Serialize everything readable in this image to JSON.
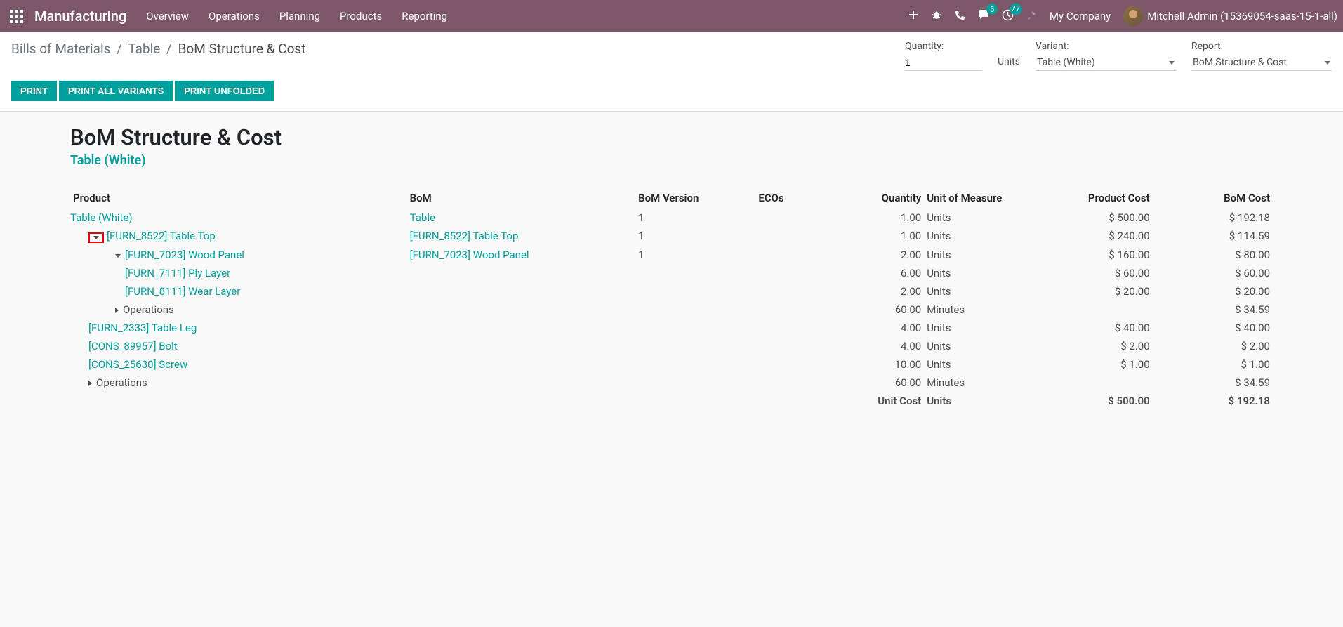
{
  "navbar": {
    "app_name": "Manufacturing",
    "menu": [
      "Overview",
      "Operations",
      "Planning",
      "Products",
      "Reporting"
    ],
    "messages_badge": "5",
    "activities_badge": "27",
    "company": "My Company",
    "user": "Mitchell Admin (15369054-saas-15-1-all)"
  },
  "breadcrumb": {
    "a": "Bills of Materials",
    "b": "Table",
    "current": "BoM Structure & Cost"
  },
  "fields": {
    "quantity_label": "Quantity:",
    "quantity_value": "1",
    "quantity_unit": "Units",
    "variant_label": "Variant:",
    "variant_value": "Table (White)",
    "report_label": "Report:",
    "report_value": "BoM Structure & Cost"
  },
  "buttons": {
    "print": "Print",
    "print_all": "Print All Variants",
    "print_unfolded": "Print Unfolded"
  },
  "report": {
    "title": "BoM Structure & Cost",
    "subtitle": "Table (White)"
  },
  "headers": {
    "product": "Product",
    "bom": "BoM",
    "version": "BoM Version",
    "ecos": "ECOs",
    "quantity": "Quantity",
    "uom": "Unit of Measure",
    "pcost": "Product Cost",
    "bcost": "BoM Cost"
  },
  "rows": [
    {
      "indent": 0,
      "caret": "",
      "product": "Table (White)",
      "link": true,
      "bom": "Table",
      "bom_link": true,
      "version": "1",
      "qty": "1.00",
      "uom": "Units",
      "pcost": "$ 500.00",
      "bcost": "$ 192.18"
    },
    {
      "indent": 1,
      "caret": "highlighted",
      "product": "[FURN_8522] Table Top",
      "link": true,
      "bom": "[FURN_8522] Table Top",
      "bom_link": true,
      "version": "1",
      "qty": "1.00",
      "uom": "Units",
      "pcost": "$ 240.00",
      "bcost": "$ 114.59"
    },
    {
      "indent": 2,
      "caret": "open",
      "product": "[FURN_7023] Wood Panel",
      "link": true,
      "bom": "[FURN_7023] Wood Panel",
      "bom_link": true,
      "version": "1",
      "qty": "2.00",
      "uom": "Units",
      "pcost": "$ 160.00",
      "bcost": "$ 80.00"
    },
    {
      "indent": 3,
      "caret": "",
      "product": "[FURN_7111] Ply Layer",
      "link": true,
      "bom": "",
      "version": "",
      "qty": "6.00",
      "uom": "Units",
      "pcost": "$ 60.00",
      "bcost": "$ 60.00"
    },
    {
      "indent": 3,
      "caret": "",
      "product": "[FURN_8111] Wear Layer",
      "link": true,
      "bom": "",
      "version": "",
      "qty": "2.00",
      "uom": "Units",
      "pcost": "$ 20.00",
      "bcost": "$ 20.00"
    },
    {
      "indent": 2,
      "caret": "closed",
      "product": "Operations",
      "link": false,
      "bom": "",
      "version": "",
      "qty": "60:00",
      "uom": "Minutes",
      "pcost": "",
      "bcost": "$ 34.59"
    },
    {
      "indent": 1,
      "caret": "",
      "product": "[FURN_2333] Table Leg",
      "link": true,
      "bom": "",
      "version": "",
      "qty": "4.00",
      "uom": "Units",
      "pcost": "$ 40.00",
      "bcost": "$ 40.00"
    },
    {
      "indent": 1,
      "caret": "",
      "product": "[CONS_89957] Bolt",
      "link": true,
      "bom": "",
      "version": "",
      "qty": "4.00",
      "uom": "Units",
      "pcost": "$ 2.00",
      "bcost": "$ 2.00"
    },
    {
      "indent": 1,
      "caret": "",
      "product": "[CONS_25630] Screw",
      "link": true,
      "bom": "",
      "version": "",
      "qty": "10.00",
      "uom": "Units",
      "pcost": "$ 1.00",
      "bcost": "$ 1.00"
    },
    {
      "indent": 1,
      "caret": "closed",
      "product": "Operations",
      "link": false,
      "bom": "",
      "version": "",
      "qty": "60:00",
      "uom": "Minutes",
      "pcost": "",
      "bcost": "$ 34.59"
    }
  ],
  "total": {
    "label": "Unit Cost",
    "uom": "Units",
    "pcost": "$ 500.00",
    "bcost": "$ 192.18"
  }
}
